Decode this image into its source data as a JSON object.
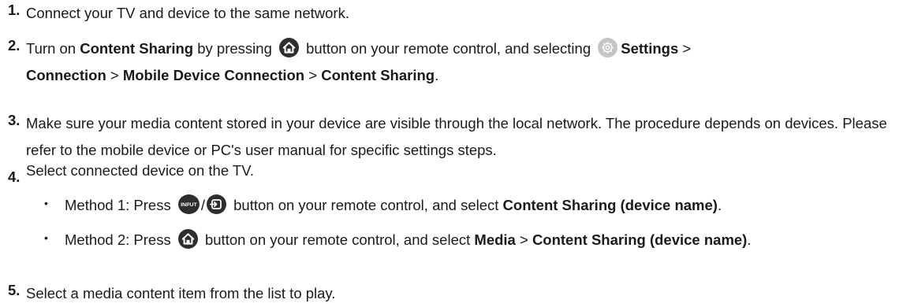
{
  "steps": {
    "s1": {
      "num": "1.",
      "text": "Connect your TV and device to the same network."
    },
    "s2": {
      "num": "2.",
      "t1": "Turn on ",
      "b1": "Content Sharing",
      "t2": " by pressing ",
      "t3": " button on your remote control, and selecting ",
      "b2": "Settings",
      "t4": " > ",
      "b3": "Connection",
      "t5": " > ",
      "b4": "Mobile Device Connection",
      "t6": " > ",
      "b5": "Content Sharing",
      "t7": "."
    },
    "s3": {
      "num": "3.",
      "text": "Make sure your media content stored in your device are visible through the local network. The procedure depends on devices. Please refer to the mobile device or PC's user manual for specific settings steps."
    },
    "s4": {
      "num": "4.",
      "text": "Select connected device on the TV."
    },
    "m1": {
      "bullet": "•",
      "t1": "Method 1: Press ",
      "sep": "/",
      "t2": " button on your remote control, and select ",
      "b1": "Content Sharing (device name)",
      "t3": "."
    },
    "m2": {
      "bullet": "•",
      "t1": "Method 2: Press ",
      "t2": " button on your remote control, and select ",
      "b1": "Media",
      "t3": " > ",
      "b2": "Content Sharing (device name)",
      "t4": "."
    },
    "s5": {
      "num": "5.",
      "text": "Select a media content item from the list to play."
    }
  },
  "icons": {
    "home_icon_color": "#2e2e2e",
    "settings_icon_color": "#b8b8b8",
    "input_icon_color": "#2e2e2e",
    "input_icon_label": "INPUT"
  }
}
